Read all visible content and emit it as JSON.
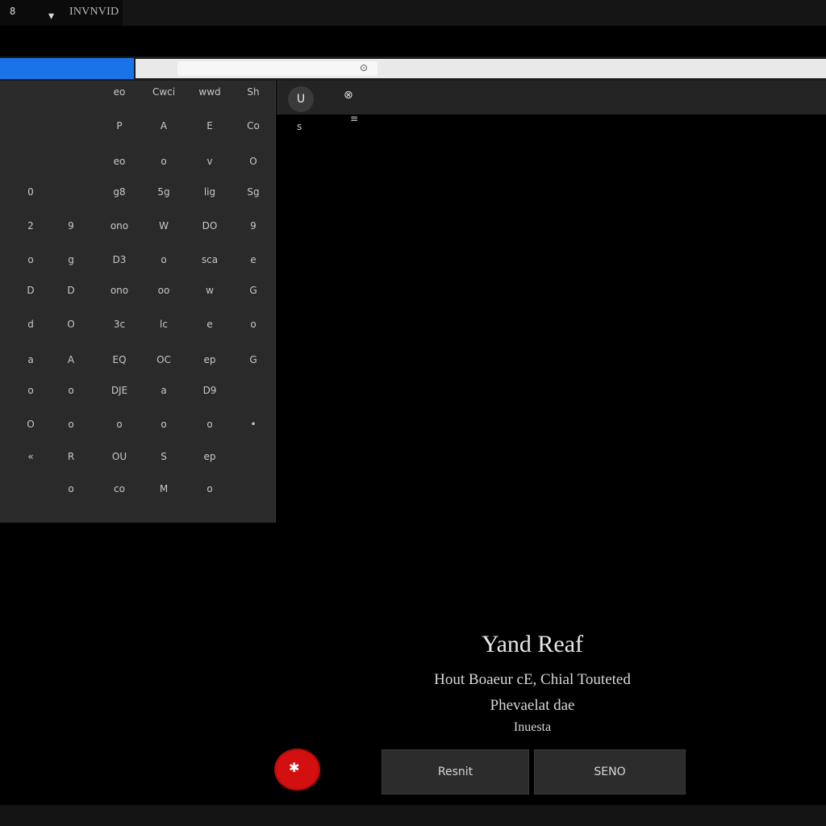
{
  "titlebar": {
    "icon_glyph": "8",
    "title": "INVNVID",
    "icon_secondary": "▾"
  },
  "addressbar": {
    "lock_glyph": "⊙"
  },
  "toolbar": {
    "user_glyph": "U",
    "tool_glyph": "⊗",
    "sub_glyph_1": "s",
    "sub_glyph_2": "≡"
  },
  "grid": {
    "cells": [
      {
        "t": "eo"
      },
      {
        "t": "Cwci"
      },
      {
        "t": "wwd"
      },
      {
        "t": "Sh"
      },
      {
        "t": "P"
      },
      {
        "t": "A"
      },
      {
        "t": "E"
      },
      {
        "t": "Co"
      },
      {
        "t": "eo"
      },
      {
        "t": "o"
      },
      {
        "t": "v"
      },
      {
        "t": "O"
      },
      {
        "t": "0"
      },
      {
        "t": "g8"
      },
      {
        "t": "5g"
      },
      {
        "t": "lig"
      },
      {
        "t": "Sg"
      },
      {
        "t": "2"
      },
      {
        "t": "9"
      },
      {
        "t": "ono"
      },
      {
        "t": "W"
      },
      {
        "t": "DO"
      },
      {
        "t": "9"
      },
      {
        "t": "o"
      },
      {
        "t": "g"
      },
      {
        "t": "D3"
      },
      {
        "t": "o"
      },
      {
        "t": "sca"
      },
      {
        "t": "e"
      },
      {
        "t": "D"
      },
      {
        "t": "D"
      },
      {
        "t": "ono"
      },
      {
        "t": "oo"
      },
      {
        "t": "w"
      },
      {
        "t": "G"
      },
      {
        "t": "d"
      },
      {
        "t": "O"
      },
      {
        "t": "3c"
      },
      {
        "t": "lc"
      },
      {
        "t": "e"
      },
      {
        "t": "o"
      },
      {
        "t": "a"
      },
      {
        "t": "A"
      },
      {
        "t": "EQ"
      },
      {
        "t": "OC"
      },
      {
        "t": "ep"
      },
      {
        "t": "G"
      },
      {
        "t": "o"
      },
      {
        "t": "o"
      },
      {
        "t": "DJE"
      },
      {
        "t": "a"
      },
      {
        "t": "D9"
      },
      {
        "t": "O"
      },
      {
        "t": "o"
      },
      {
        "t": "o"
      },
      {
        "t": "o"
      },
      {
        "t": "o"
      },
      {
        "t": "•"
      },
      {
        "t": "«"
      },
      {
        "t": "R"
      },
      {
        "t": "OU"
      },
      {
        "t": "S"
      },
      {
        "t": "ep"
      },
      {
        "t": "o"
      },
      {
        "t": "co"
      },
      {
        "t": "M"
      },
      {
        "t": "o"
      }
    ]
  },
  "dialog": {
    "title": "Yand Reaf",
    "line1": "Hout Boaeur cE, Chial Touteted",
    "line2": "Phevaelat dae",
    "line3": "Inuesta"
  },
  "actions": {
    "record_glyph": "✱",
    "left_label": "Resnit",
    "right_label": "SENO"
  },
  "colors": {
    "accent": "#1a73e8",
    "record": "#d40f0f"
  }
}
